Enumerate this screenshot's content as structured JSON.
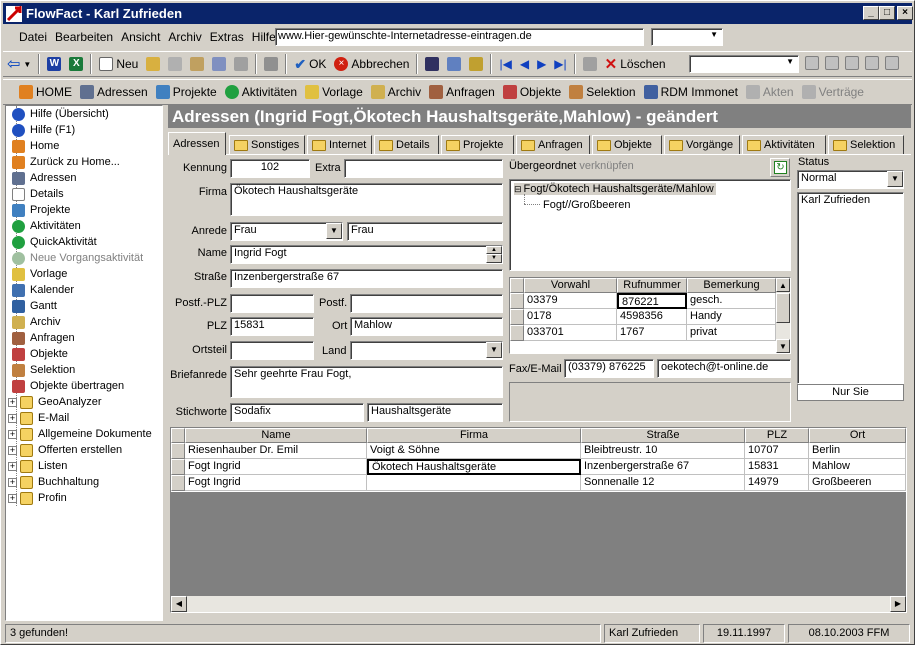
{
  "window": {
    "title": "FlowFact - Karl Zufrieden",
    "min": "_",
    "max": "□",
    "close": "×"
  },
  "menu": {
    "items": [
      "Datei",
      "Bearbeiten",
      "Ansicht",
      "Archiv",
      "Extras",
      "Hilfe ?"
    ],
    "url": "www.Hier-gewünschte-Internetadresse-eintragen.de",
    "url_dropdown": ""
  },
  "toolbar1": {
    "new": "Neu",
    "ok": "OK",
    "cancel": "Abbrechen",
    "delete": "Löschen"
  },
  "toolbar2": {
    "items": [
      "HOME",
      "Adressen",
      "Projekte",
      "Aktivitäten",
      "Vorlage",
      "Archiv",
      "Anfragen",
      "Objekte",
      "Selektion",
      "RDM Immonet",
      "Akten",
      "Verträge"
    ]
  },
  "tree": {
    "items": [
      "Hilfe (Übersicht)",
      "Hilfe (F1)",
      "Home",
      "Zurück zu Home...",
      "Adressen",
      "Details",
      "Projekte",
      "Aktivitäten",
      "QuickAktivität",
      "Neue Vorgangsaktivität",
      "Vorlage",
      "Kalender",
      "Gantt",
      "Archiv",
      "Anfragen",
      "Objekte",
      "Selektion",
      "Objekte übertragen"
    ],
    "folders": [
      "GeoAnalyzer",
      "E-Mail",
      "Allgemeine Dokumente",
      "Offerten erstellen",
      "Listen",
      "Buchhaltung",
      "Profin"
    ]
  },
  "header": {
    "title": "Adressen (Ingrid Fogt,Ökotech Haushaltsgeräte,Mahlow) - geändert"
  },
  "tabs": [
    "Adressen",
    "Sonstiges",
    "Internet",
    "Details",
    "Projekte",
    "Anfragen",
    "Objekte",
    "Vorgänge",
    "Aktivitäten",
    "Selektion"
  ],
  "form": {
    "kennung_label": "Kennung",
    "kennung": "102",
    "extra_label": "Extra",
    "extra": "",
    "firma_label": "Firma",
    "firma": "Ökotech Haushaltsgeräte",
    "anrede_label": "Anrede",
    "anrede": "Frau",
    "anrede2": "Frau",
    "name_label": "Name",
    "name": "Ingrid Fogt",
    "strasse_label": "Straße",
    "strasse": "Inzenbergerstraße 67",
    "postfplz_label": "Postf.-PLZ",
    "postfplz": "",
    "postf_label": "Postf.",
    "postf": "",
    "plz_label": "PLZ",
    "plz": "15831",
    "ort_label": "Ort",
    "ort": "Mahlow",
    "ortsteil_label": "Ortsteil",
    "ortsteil": "",
    "land_label": "Land",
    "land": "",
    "briefanrede_label": "Briefanrede",
    "briefanrede": "Sehr geehrte Frau Fogt,",
    "stichworte_label": "Stichworte",
    "stichwort1": "Sodafix",
    "stichwort2": "Haushaltsgeräte"
  },
  "parent": {
    "label": "Übergeordnet",
    "link": "verknüpfen",
    "tree": [
      "Fogt/Ökotech Haushaltsgeräte/Mahlow",
      "Fogt//Großbeeren"
    ]
  },
  "status": {
    "label": "Status",
    "value": "Normal",
    "list": [
      "Karl Zufrieden"
    ],
    "footer": "Nur Sie"
  },
  "phones": {
    "headers": [
      "Vorwahl",
      "Rufnummer",
      "Bemerkung"
    ],
    "rows": [
      [
        "03379",
        "876221",
        "gesch."
      ],
      [
        "0178",
        "4598356",
        "Handy"
      ],
      [
        "033701",
        "1767",
        "privat"
      ]
    ]
  },
  "fax": {
    "label": "Fax/E-Mail",
    "fax": "(03379)  876225",
    "email": "oekotech@t-online.de"
  },
  "results": {
    "headers": [
      "Name",
      "Firma",
      "Straße",
      "PLZ",
      "Ort"
    ],
    "rows": [
      [
        "Riesenhauber Dr. Emil",
        "Voigt & Söhne",
        "Bleibtreustr. 10",
        "10707",
        "Berlin"
      ],
      [
        "Fogt Ingrid",
        "Ökotech Haushaltsgeräte",
        "Inzenbergerstraße 67",
        "15831",
        "Mahlow"
      ],
      [
        "Fogt Ingrid",
        "",
        "Sonnenalle 12",
        "14979",
        "Großbeeren"
      ]
    ]
  },
  "statusbar": {
    "found": "3 gefunden!",
    "user": "Karl Zufrieden",
    "date1": "19.11.1997",
    "date2": "08.10.2003 FFM"
  }
}
